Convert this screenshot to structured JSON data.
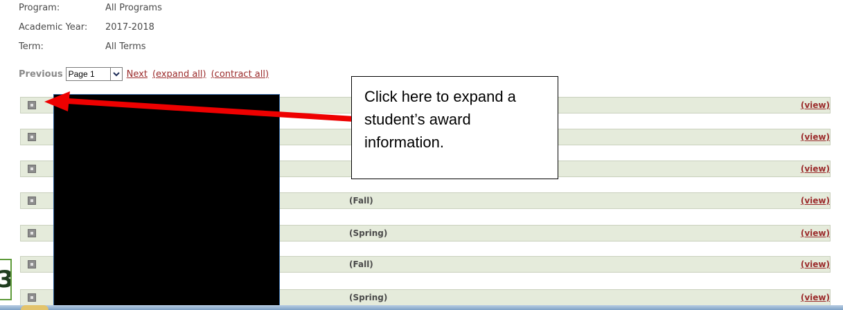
{
  "filters": {
    "program_label": "Program:",
    "program_value": "All Programs",
    "year_label": "Academic Year:",
    "year_value": "2017-2018",
    "term_label": "Term:",
    "term_value": "All Terms"
  },
  "pager": {
    "previous": "Previous",
    "page_select": "Page 1",
    "next": "Next",
    "expand_all": "(expand all)",
    "contract_all": "(contract all)"
  },
  "rows": [
    {
      "term": "",
      "view": "(view)"
    },
    {
      "term": "",
      "view": "(view)"
    },
    {
      "term": "",
      "view": "(view)"
    },
    {
      "term": "(Fall)",
      "view": "(view)"
    },
    {
      "term": "(Spring)",
      "view": "(view)"
    },
    {
      "term": "(Fall)",
      "view": "(view)"
    },
    {
      "term": "(Spring)",
      "view": "(view)"
    }
  ],
  "callout": {
    "text": "Click here to expand a student’s award information."
  },
  "edge_fragment": "3",
  "colors": {
    "row_background": "#e5ebdb",
    "link": "#9b2b2b",
    "annotation_arrow": "#ee0000",
    "redaction": "#000000"
  }
}
